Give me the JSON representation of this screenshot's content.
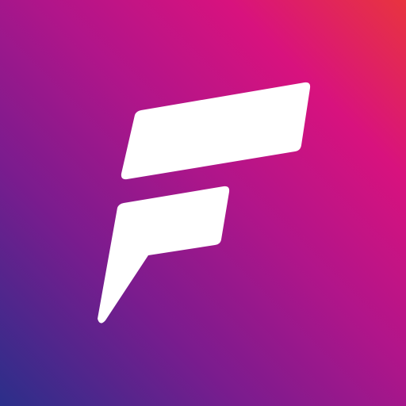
{
  "app_icon": {
    "description_name": "app icon",
    "logo_color": "#ffffff",
    "gradient_colors": [
      "#2b2f8a",
      "#7a1c8e",
      "#b0158a",
      "#d8127e",
      "#e8343f"
    ]
  }
}
